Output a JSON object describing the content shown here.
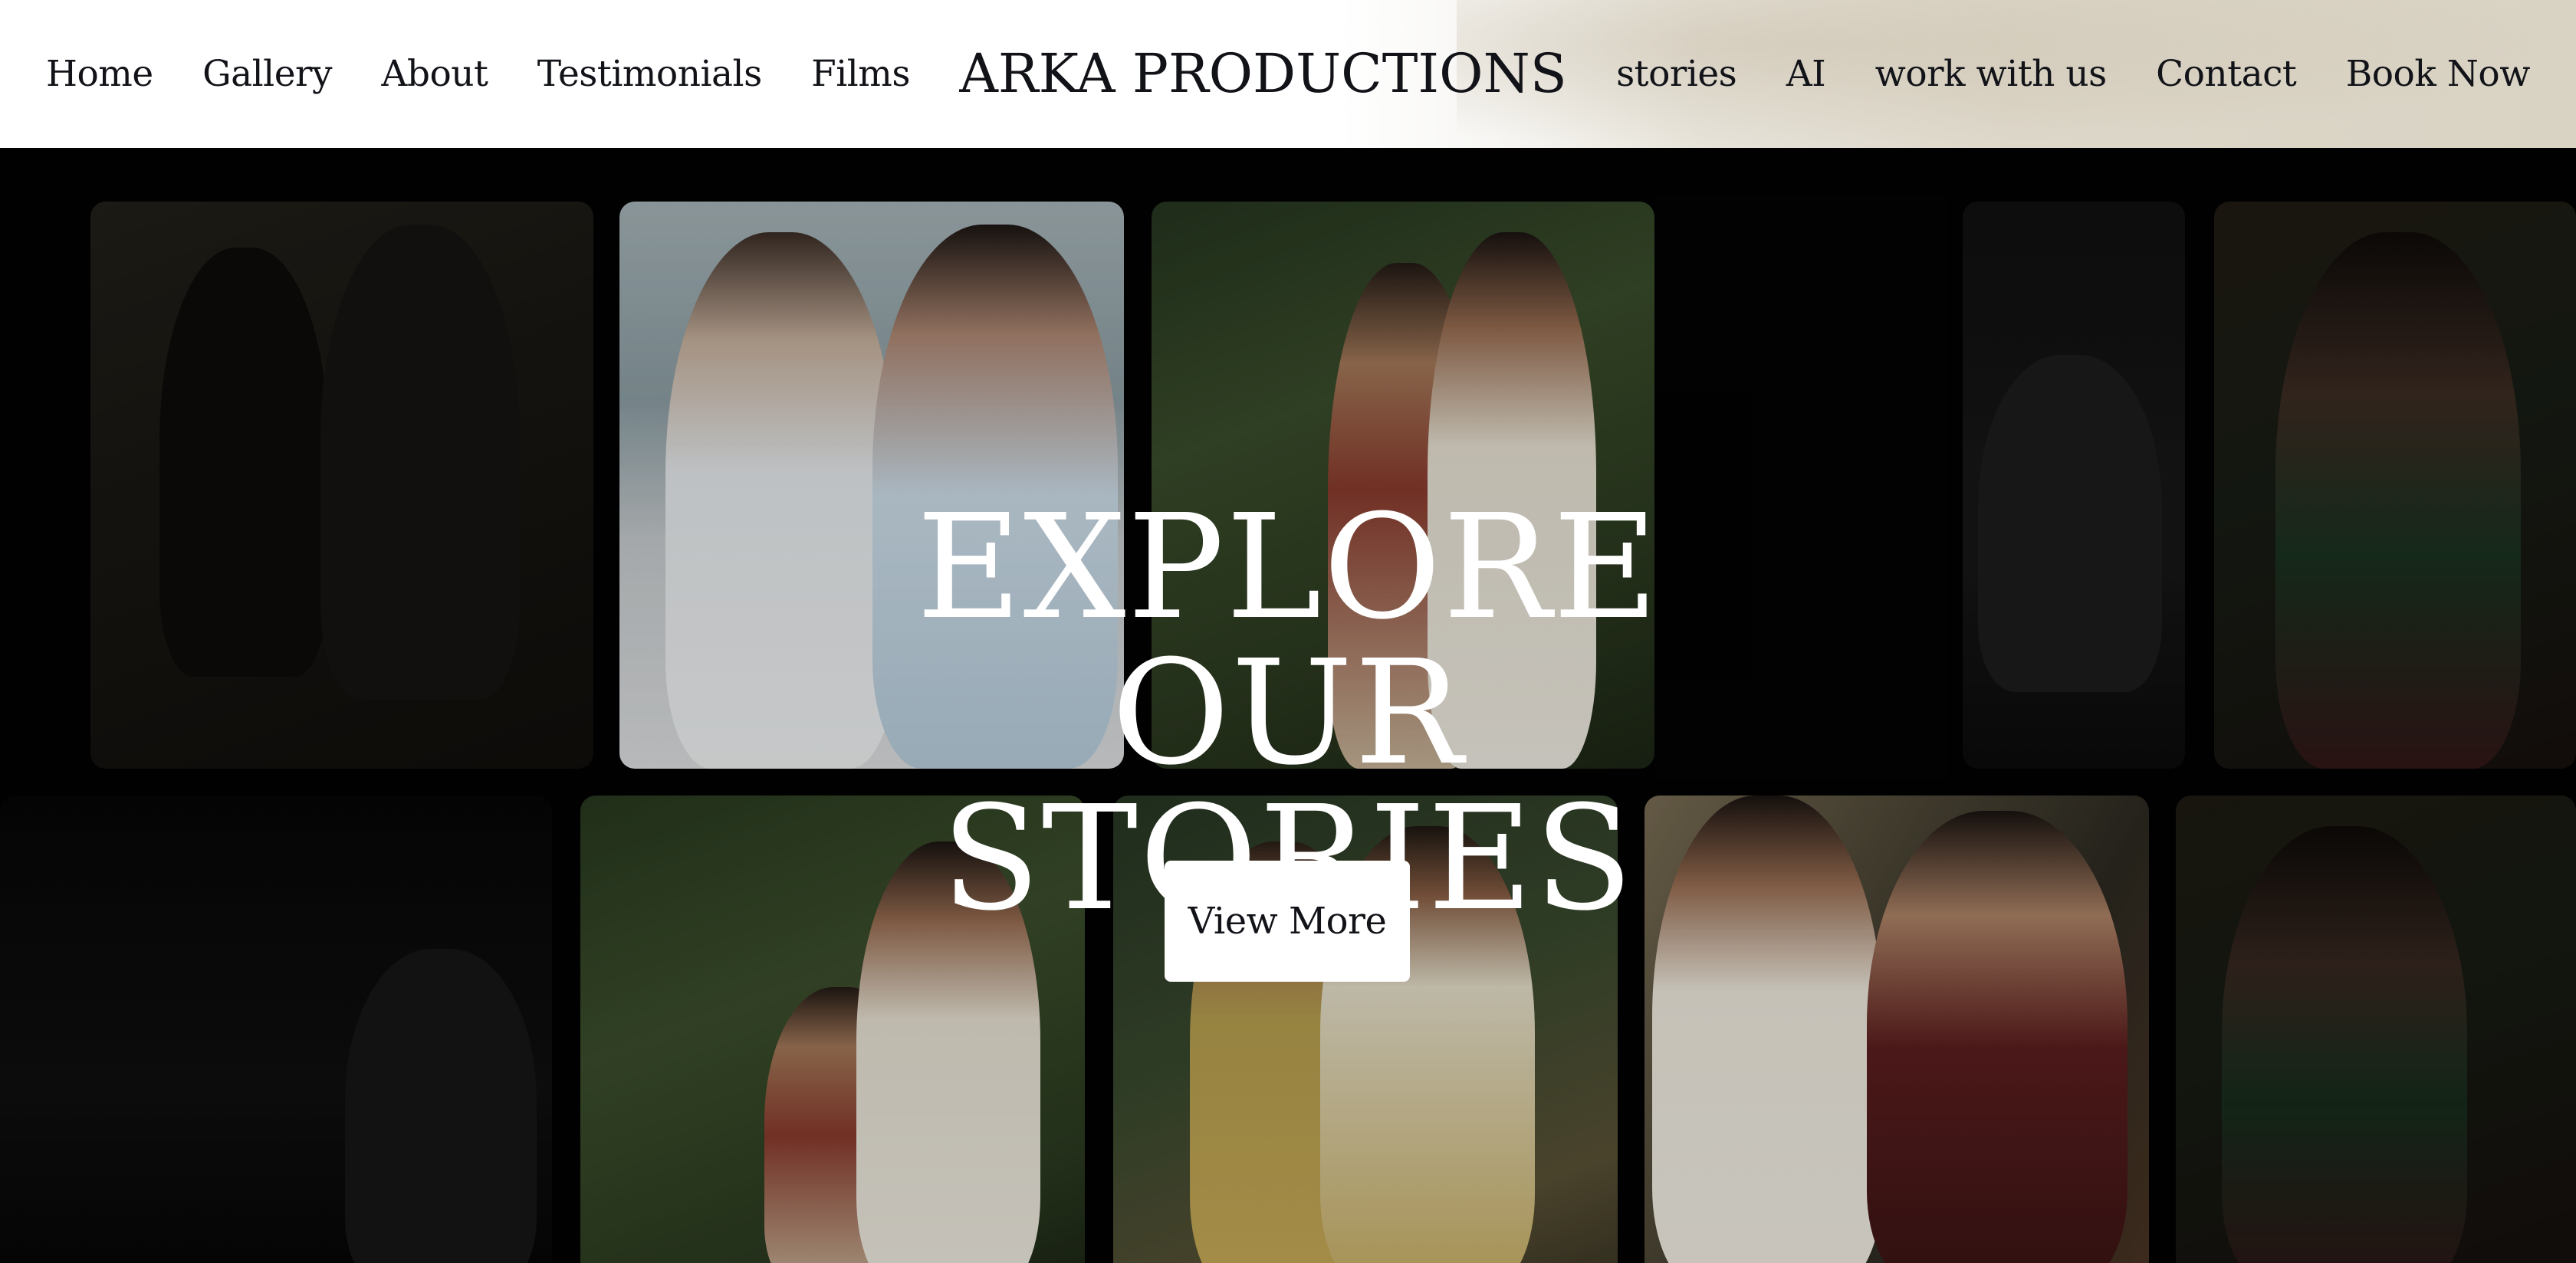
{
  "nav": {
    "left_links": [
      {
        "label": "Home"
      },
      {
        "label": "Gallery"
      },
      {
        "label": "About"
      },
      {
        "label": "Testimonials"
      },
      {
        "label": "Films"
      }
    ],
    "brand": "ARKA PRODUCTIONS",
    "right_links": [
      {
        "label": "stories"
      },
      {
        "label": "AI"
      },
      {
        "label": "work with us"
      },
      {
        "label": "Contact"
      },
      {
        "label": "Book Now"
      }
    ]
  },
  "hero": {
    "title_line1": "EXPLORE OUR",
    "title_line2": "STORIES",
    "cta_label": "View More"
  },
  "colors": {
    "nav_background": "#ffffff",
    "text_dark": "#111318",
    "hero_background": "#020202",
    "hero_text": "#ffffff",
    "button_background": "#ffffff"
  }
}
